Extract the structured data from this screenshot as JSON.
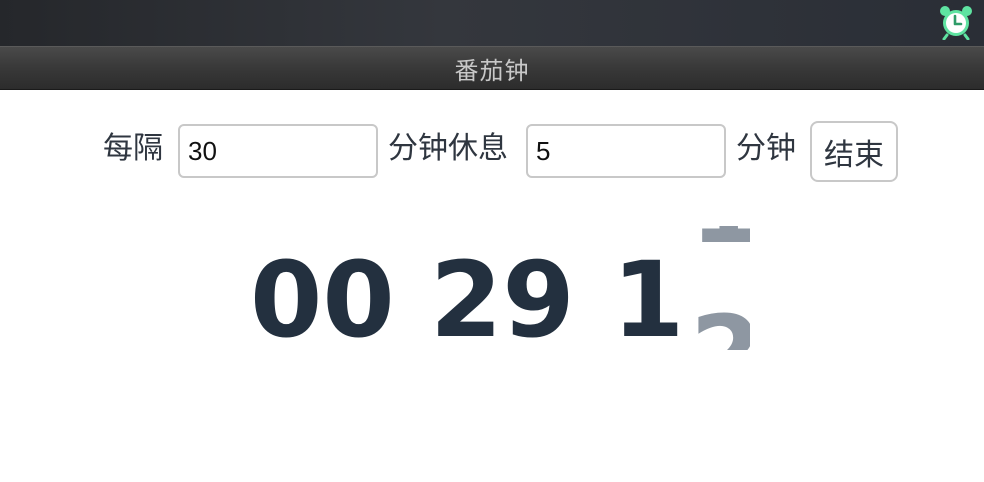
{
  "app": {
    "title": "番茄钟"
  },
  "statusbar": {
    "icon": "alarm-clock-icon",
    "icon_color": "#5fe3a1"
  },
  "settings": {
    "every_label": "每隔",
    "work_minutes": "30",
    "minutes_rest_label": "分钟休息",
    "rest_minutes": "5",
    "minutes_label": "分钟",
    "end_button": "结束"
  },
  "timer": {
    "hours": "00",
    "minutes": "29",
    "seconds_tens": "1",
    "seconds_ones_outgoing": "1",
    "seconds_ones_incoming": "2",
    "digit_color": "#23303f",
    "animating_color": "#8e97a2"
  }
}
